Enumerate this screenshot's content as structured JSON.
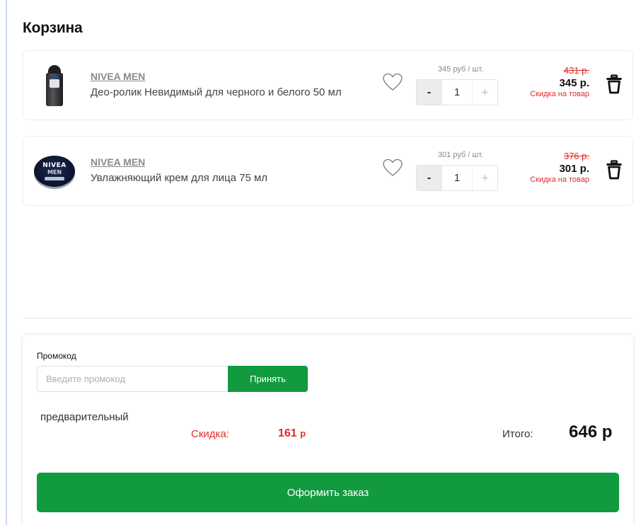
{
  "cart": {
    "title": "Корзина",
    "items": [
      {
        "brand": "NIVEA MEN",
        "name": "Део-ролик Невидимый для черного и белого 50 мл",
        "unit_price": "345 руб / шт.",
        "quantity": "1",
        "minus_label": "-",
        "plus_label": "+",
        "old_price": "431 р.",
        "price": "345 р.",
        "discount_note": "Скидка на товар",
        "image_icon": "deodorant-roller-icon"
      },
      {
        "brand": "NIVEA MEN",
        "name": "Увлажняющий крем для лица 75 мл",
        "unit_price": "301 руб / шт.",
        "quantity": "1",
        "minus_label": "-",
        "plus_label": "+",
        "old_price": "376 р.",
        "price": "301 р.",
        "discount_note": "Скидка на товар",
        "image_icon": "cream-tin-icon",
        "image_text_1": "NIVEA",
        "image_text_2": "MEN"
      }
    ]
  },
  "summary": {
    "promo_label": "Промокод",
    "promo_placeholder": "Введите промокод",
    "promo_button": "Принять",
    "prelim_label": "предварительный",
    "discount_label": "Скидка:",
    "discount_value": "161",
    "discount_unit": "р",
    "total_label": "Итого:",
    "total_value": "646 р",
    "order_button": "Оформить заказ"
  },
  "colors": {
    "accent_green": "#129a3e",
    "discount_red": "#e52a2a",
    "brand_gray": "#8a8a8a"
  },
  "icons": {
    "favorite": "heart-outline-icon",
    "remove": "trash-icon"
  }
}
